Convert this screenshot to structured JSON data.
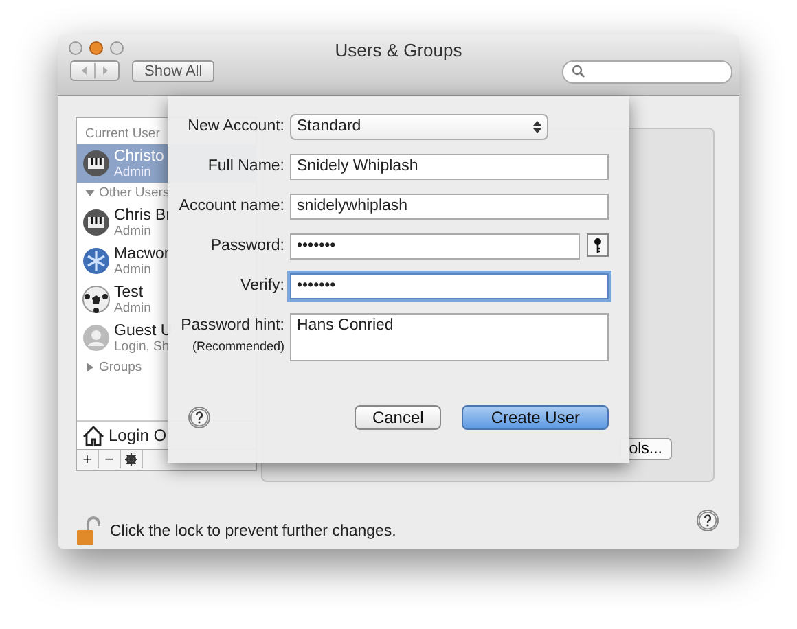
{
  "window": {
    "title": "Users & Groups",
    "show_all": "Show All"
  },
  "sidebar": {
    "sections": [
      {
        "title": "Current User",
        "users": [
          {
            "name": "Christo",
            "role": "Admin",
            "kind": "keys",
            "selected": true
          }
        ]
      },
      {
        "title": "Other Users",
        "expanded": true,
        "users": [
          {
            "name": "Chris Br",
            "role": "Admin",
            "kind": "keys",
            "selected": false
          },
          {
            "name": "Macwor",
            "role": "Admin",
            "kind": "flake",
            "selected": false
          },
          {
            "name": "Test",
            "role": "Admin",
            "kind": "ball",
            "selected": false
          },
          {
            "name": "Guest U",
            "role": "Login, Sh",
            "kind": "guest",
            "selected": false
          }
        ]
      },
      {
        "title": "Groups",
        "expanded": false
      }
    ],
    "login_options": "Login O",
    "add": "+",
    "remove": "−"
  },
  "panel": {
    "button": "ols..."
  },
  "lock": {
    "text": "Click the lock to prevent further changes."
  },
  "sheet": {
    "fields": [
      {
        "label": "New Account:",
        "kind": "select",
        "value": "Standard",
        "focused": false
      },
      {
        "label": "Full Name:",
        "kind": "text",
        "value": "Snidely Whiplash",
        "focused": false
      },
      {
        "label": "Account name:",
        "kind": "text",
        "value": "snidelywhiplash",
        "focused": false
      },
      {
        "label": "Password:",
        "kind": "password",
        "value": "•••••••",
        "focused": false,
        "has_key": true
      },
      {
        "label": "Verify:",
        "kind": "password",
        "value": "•••••••",
        "focused": true,
        "has_key": false
      },
      {
        "label": "Password hint:",
        "sublabel": "(Recommended)",
        "kind": "textarea",
        "value": "Hans Conried",
        "focused": false
      }
    ],
    "buttons": [
      {
        "label": "Cancel",
        "default": false
      },
      {
        "label": "Create User",
        "default": true
      }
    ]
  }
}
